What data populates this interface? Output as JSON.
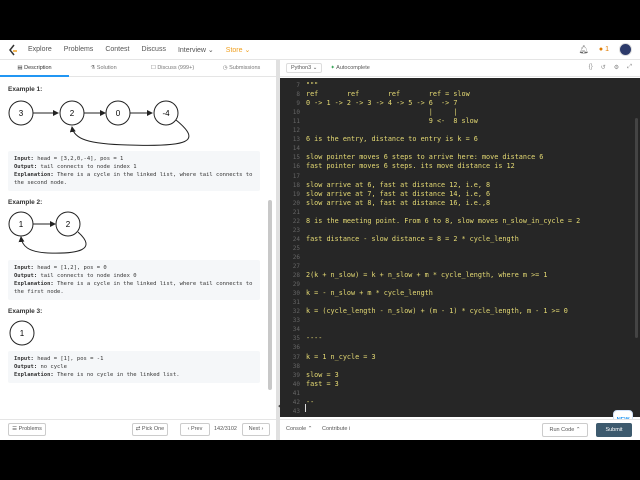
{
  "nav": {
    "items": [
      "Explore",
      "Problems",
      "Contest",
      "Discuss",
      "Interview",
      "Store"
    ],
    "coins": "1"
  },
  "tabs": [
    "Description",
    "Solution",
    "Discuss (999+)",
    "Submissions"
  ],
  "examples": [
    {
      "title": "Example 1:",
      "nodes": [
        "3",
        "2",
        "0",
        "-4"
      ],
      "input_label": "Input:",
      "input": "head = [3,2,0,-4], pos = 1",
      "output_label": "Output:",
      "output": "tail connects to node index 1",
      "explanation_label": "Explanation:",
      "explanation1": "There is a cycle in the linked list, where tail connects to",
      "explanation2": "the second node."
    },
    {
      "title": "Example 2:",
      "nodes": [
        "1",
        "2"
      ],
      "input_label": "Input:",
      "input": "head = [1,2], pos = 0",
      "output_label": "Output:",
      "output": "tail connects to node index 0",
      "explanation_label": "Explanation:",
      "explanation1": "There is a cycle in the linked list, where tail connects to",
      "explanation2": "the first node."
    },
    {
      "title": "Example 3:",
      "nodes": [
        "1"
      ],
      "input_label": "Input:",
      "input": "head = [1], pos = -1",
      "output_label": "Output:",
      "output": "no cycle",
      "explanation_label": "Explanation:",
      "explanation1": "There is no cycle in the linked list."
    }
  ],
  "bottom_left": {
    "problems": "Problems",
    "pick_one": "Pick One",
    "prev": "Prev",
    "page": "142/3102",
    "next": "Next"
  },
  "editor": {
    "language": "Python3",
    "autocomplete": "Autocomplete",
    "lines": [
      {
        "n": "7",
        "t": "\"\"\""
      },
      {
        "n": "8",
        "t": "ref       ref       ref       ref = slow"
      },
      {
        "n": "9",
        "t": "0 -> 1 -> 2 -> 3 -> 4 -> 5 -> 6  -> 7"
      },
      {
        "n": "10",
        "t": "                              |     |"
      },
      {
        "n": "11",
        "t": "                              9 <-  8 slow"
      },
      {
        "n": "12",
        "t": ""
      },
      {
        "n": "13",
        "t": "6 is the entry, distance to entry is k = 6"
      },
      {
        "n": "14",
        "t": ""
      },
      {
        "n": "15",
        "t": "slow pointer moves 6 steps to arrive here: move distance 6"
      },
      {
        "n": "16",
        "t": "fast pointer moves 6 steps. its move distance is 12"
      },
      {
        "n": "17",
        "t": ""
      },
      {
        "n": "18",
        "t": "slow arrive at 6, fast at distance 12, i.e, 8"
      },
      {
        "n": "19",
        "t": "slow arrive at 7, fast at distance 14, i.e, 6"
      },
      {
        "n": "20",
        "t": "slow arrive at 8, fast at distance 16, i.e.,8"
      },
      {
        "n": "21",
        "t": ""
      },
      {
        "n": "22",
        "t": "8 is the meeting point. From 6 to 8, slow moves n_slow_in_cycle = 2"
      },
      {
        "n": "23",
        "t": ""
      },
      {
        "n": "24",
        "t": "fast distance - slow distance = 8 = 2 * cycle_length"
      },
      {
        "n": "25",
        "t": ""
      },
      {
        "n": "26",
        "t": ""
      },
      {
        "n": "27",
        "t": ""
      },
      {
        "n": "28",
        "t": "2(k + n_slow) = k + n_slow + m * cycle_length, where m >= 1"
      },
      {
        "n": "29",
        "t": ""
      },
      {
        "n": "30",
        "t": "k = - n_slow + m * cycle_length"
      },
      {
        "n": "31",
        "t": ""
      },
      {
        "n": "32",
        "t": "k = (cycle_length - n_slow) + (m - 1) * cycle_length, m - 1 >= 0"
      },
      {
        "n": "33",
        "t": ""
      },
      {
        "n": "34",
        "t": ""
      },
      {
        "n": "35",
        "t": "----"
      },
      {
        "n": "36",
        "t": ""
      },
      {
        "n": "37",
        "t": "k = 1 n_cycle = 3"
      },
      {
        "n": "38",
        "t": ""
      },
      {
        "n": "39",
        "t": "slow = 3"
      },
      {
        "n": "40",
        "t": "fast = 3"
      },
      {
        "n": "41",
        "t": ""
      },
      {
        "n": "42",
        "t": "--"
      },
      {
        "n": "43",
        "t": ""
      }
    ]
  },
  "bottom_right": {
    "console": "Console",
    "contribute": "Contribute i",
    "run": "Run Code",
    "submit": "Submit",
    "new_badge": "NEW"
  }
}
